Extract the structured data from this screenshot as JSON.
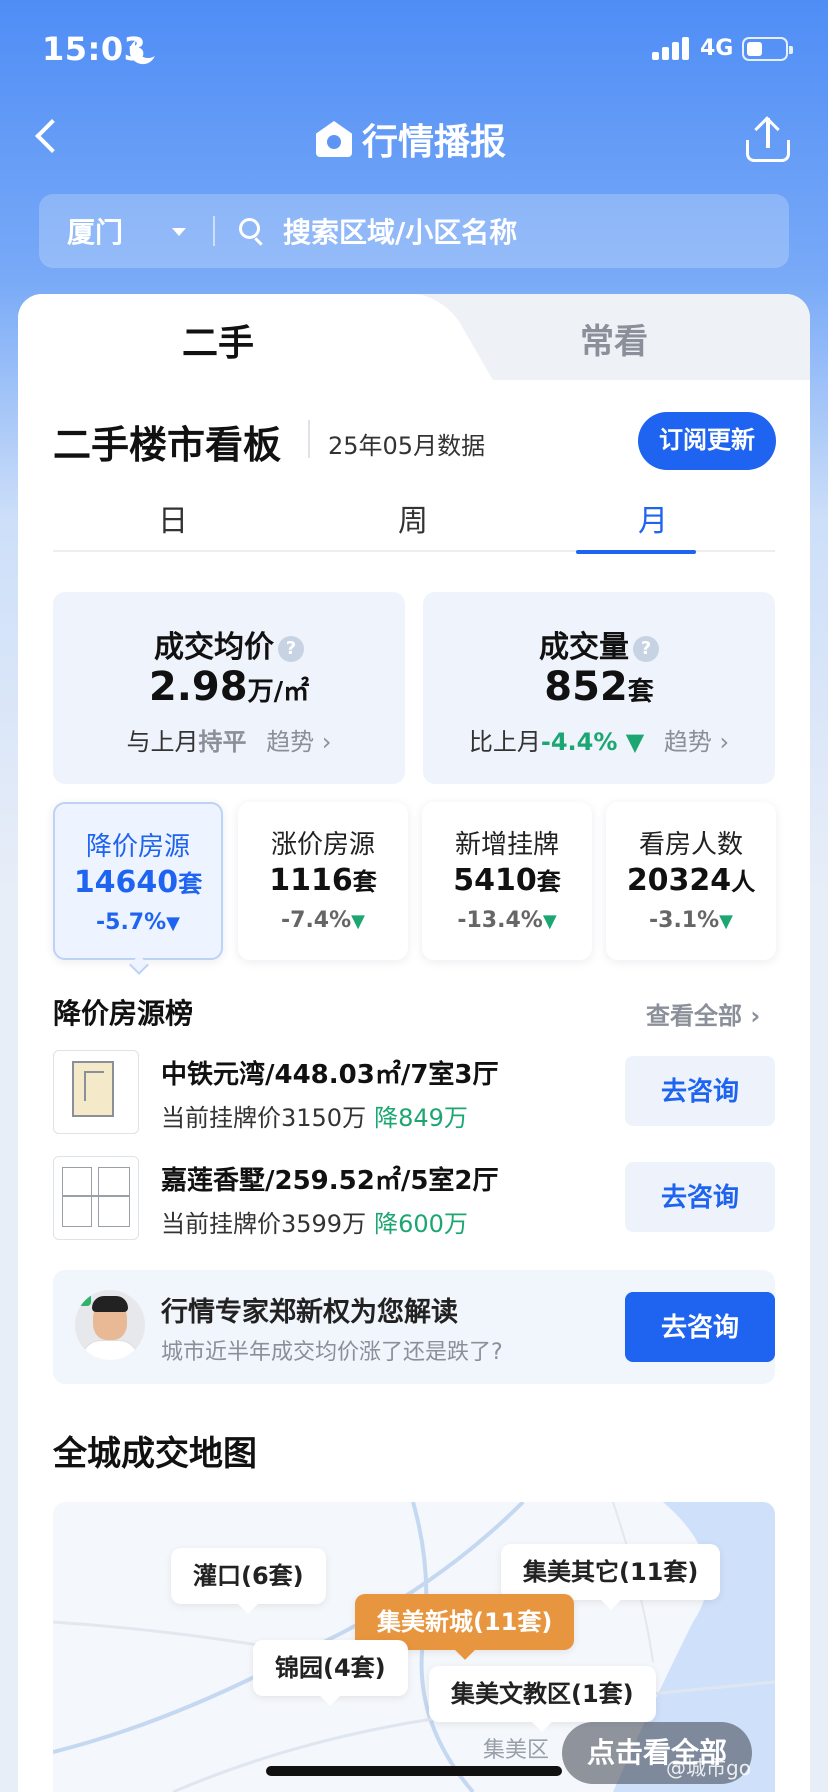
{
  "status": {
    "time": "15:03",
    "network": "4G"
  },
  "nav": {
    "title": "行情播报"
  },
  "search": {
    "city": "厦门",
    "placeholder": "搜索区域/小区名称"
  },
  "tabs": [
    "二手",
    "常看"
  ],
  "board": {
    "title": "二手楼市看板",
    "date": "25年05月数据",
    "subscribe": "订阅更新"
  },
  "periods": [
    "日",
    "周",
    "月"
  ],
  "stats_big": [
    {
      "label": "成交均价",
      "value": "2.98",
      "unit": "万/㎡",
      "compare_prefix": "与上月",
      "compare_value": "持平",
      "trend": "趋势"
    },
    {
      "label": "成交量",
      "value": "852",
      "unit": "套",
      "compare_prefix": "比上月",
      "compare_value": "-4.4%",
      "trend": "趋势"
    }
  ],
  "stats_small": [
    {
      "label": "降价房源",
      "value": "14640",
      "unit": "套",
      "change": "-5.7%"
    },
    {
      "label": "涨价房源",
      "value": "1116",
      "unit": "套",
      "change": "-7.4%"
    },
    {
      "label": "新增挂牌",
      "value": "5410",
      "unit": "套",
      "change": "-13.4%"
    },
    {
      "label": "看房人数",
      "value": "20324",
      "unit": "人",
      "change": "-3.1%"
    }
  ],
  "ranking": {
    "title": "降价房源榜",
    "see_all": "查看全部",
    "items": [
      {
        "title": "中铁元湾/448.03㎡/7室3厅",
        "price": "当前挂牌价3150万",
        "drop": "降849万",
        "button": "去咨询"
      },
      {
        "title": "嘉莲香墅/259.52㎡/5室2厅",
        "price": "当前挂牌价3599万",
        "drop": "降600万",
        "button": "去咨询"
      }
    ]
  },
  "expert": {
    "title": "行情专家郑新权为您解读",
    "subtitle": "城市近半年成交均价涨了还是跌了?",
    "button": "去咨询"
  },
  "map": {
    "title": "全城成交地图",
    "pins": [
      "灌口(6套)",
      "集美其它(11套)",
      "集美新城(11套)",
      "锦园(4套)",
      "集美文教区(1套)"
    ],
    "area_label": "集美区",
    "view_all": "点击看全部",
    "watermark": "@城市go"
  },
  "colors": {
    "primary": "#1e64f0",
    "down": "#1ba672",
    "highlight_pin": "#e8953f"
  }
}
